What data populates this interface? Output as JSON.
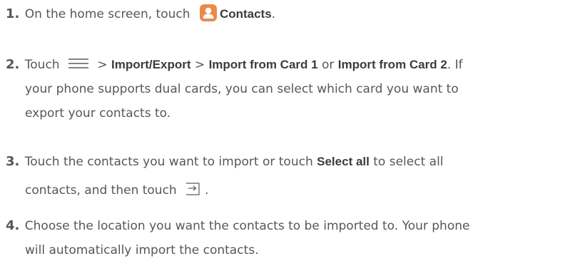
{
  "steps": [
    {
      "num": "1.",
      "pre": "On the home screen, touch ",
      "bold1": "Contacts",
      "post": "."
    },
    {
      "num": "2.",
      "t1": "Touch ",
      "sep1": " > ",
      "bold1": "Import/Export",
      "sep2": " > ",
      "bold2": "Import from Card 1",
      "mid": " or ",
      "bold3": "Import from Card 2",
      "tail": ". If",
      "line2": "your phone supports dual cards, you can select which card you want to",
      "line3": "export your contacts to."
    },
    {
      "num": "3.",
      "t1": "Touch the contacts you want to import or touch ",
      "bold1": "Select all",
      "t2": " to select all",
      "line2": "contacts, and then touch ",
      "line2end": "."
    },
    {
      "num": "4.",
      "line1": "Choose the location you want the contacts to be imported to. Your phone",
      "line2": "will automatically import the contacts."
    }
  ],
  "icons": {
    "contacts": "contacts-app-icon",
    "menu": "menu-icon",
    "export": "export-icon"
  },
  "colors": {
    "text": "#575757",
    "bold": "#3c3c3c",
    "app_icon": "#e88b4b"
  }
}
